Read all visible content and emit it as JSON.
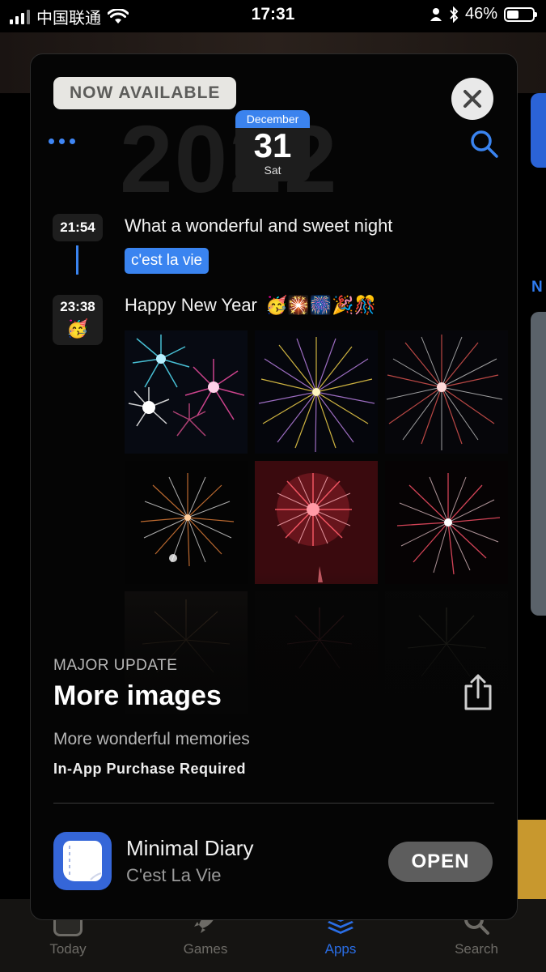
{
  "status_bar": {
    "carrier": "中国联通",
    "time": "17:31",
    "battery": "46%",
    "battery_level": 0.46
  },
  "background": {
    "partial_text": "N"
  },
  "tab_bar": {
    "tabs": [
      {
        "label": "Today",
        "icon": "today-icon",
        "active": false
      },
      {
        "label": "Games",
        "icon": "rocket-icon",
        "active": false
      },
      {
        "label": "Apps",
        "icon": "layers-icon",
        "active": true
      },
      {
        "label": "Search",
        "icon": "search-icon",
        "active": false
      }
    ],
    "active_color": "#2a6ee6"
  },
  "card": {
    "badge": "NOW AVAILABLE",
    "screenshot": {
      "year": "2022",
      "date": {
        "month": "December",
        "day": "31",
        "weekday": "Sat"
      },
      "entries": [
        {
          "time": "21:54",
          "text": "What a wonderful and sweet night",
          "tag": "c'est la vie"
        },
        {
          "time": "23:38",
          "text": "Happy New Year",
          "emoji": "🥳🎇🎆🎉🎊",
          "mood": "🥳"
        }
      ],
      "accent": "#3a84f0"
    },
    "eyebrow": "MAJOR UPDATE",
    "title": "More images",
    "description": "More wonderful memories",
    "iap": "In-App Purchase Required",
    "app": {
      "name": "Minimal Diary",
      "subtitle": "C'est La Vie",
      "button": "OPEN",
      "icon": "diary-icon",
      "icon_color": "#3566d8"
    }
  }
}
